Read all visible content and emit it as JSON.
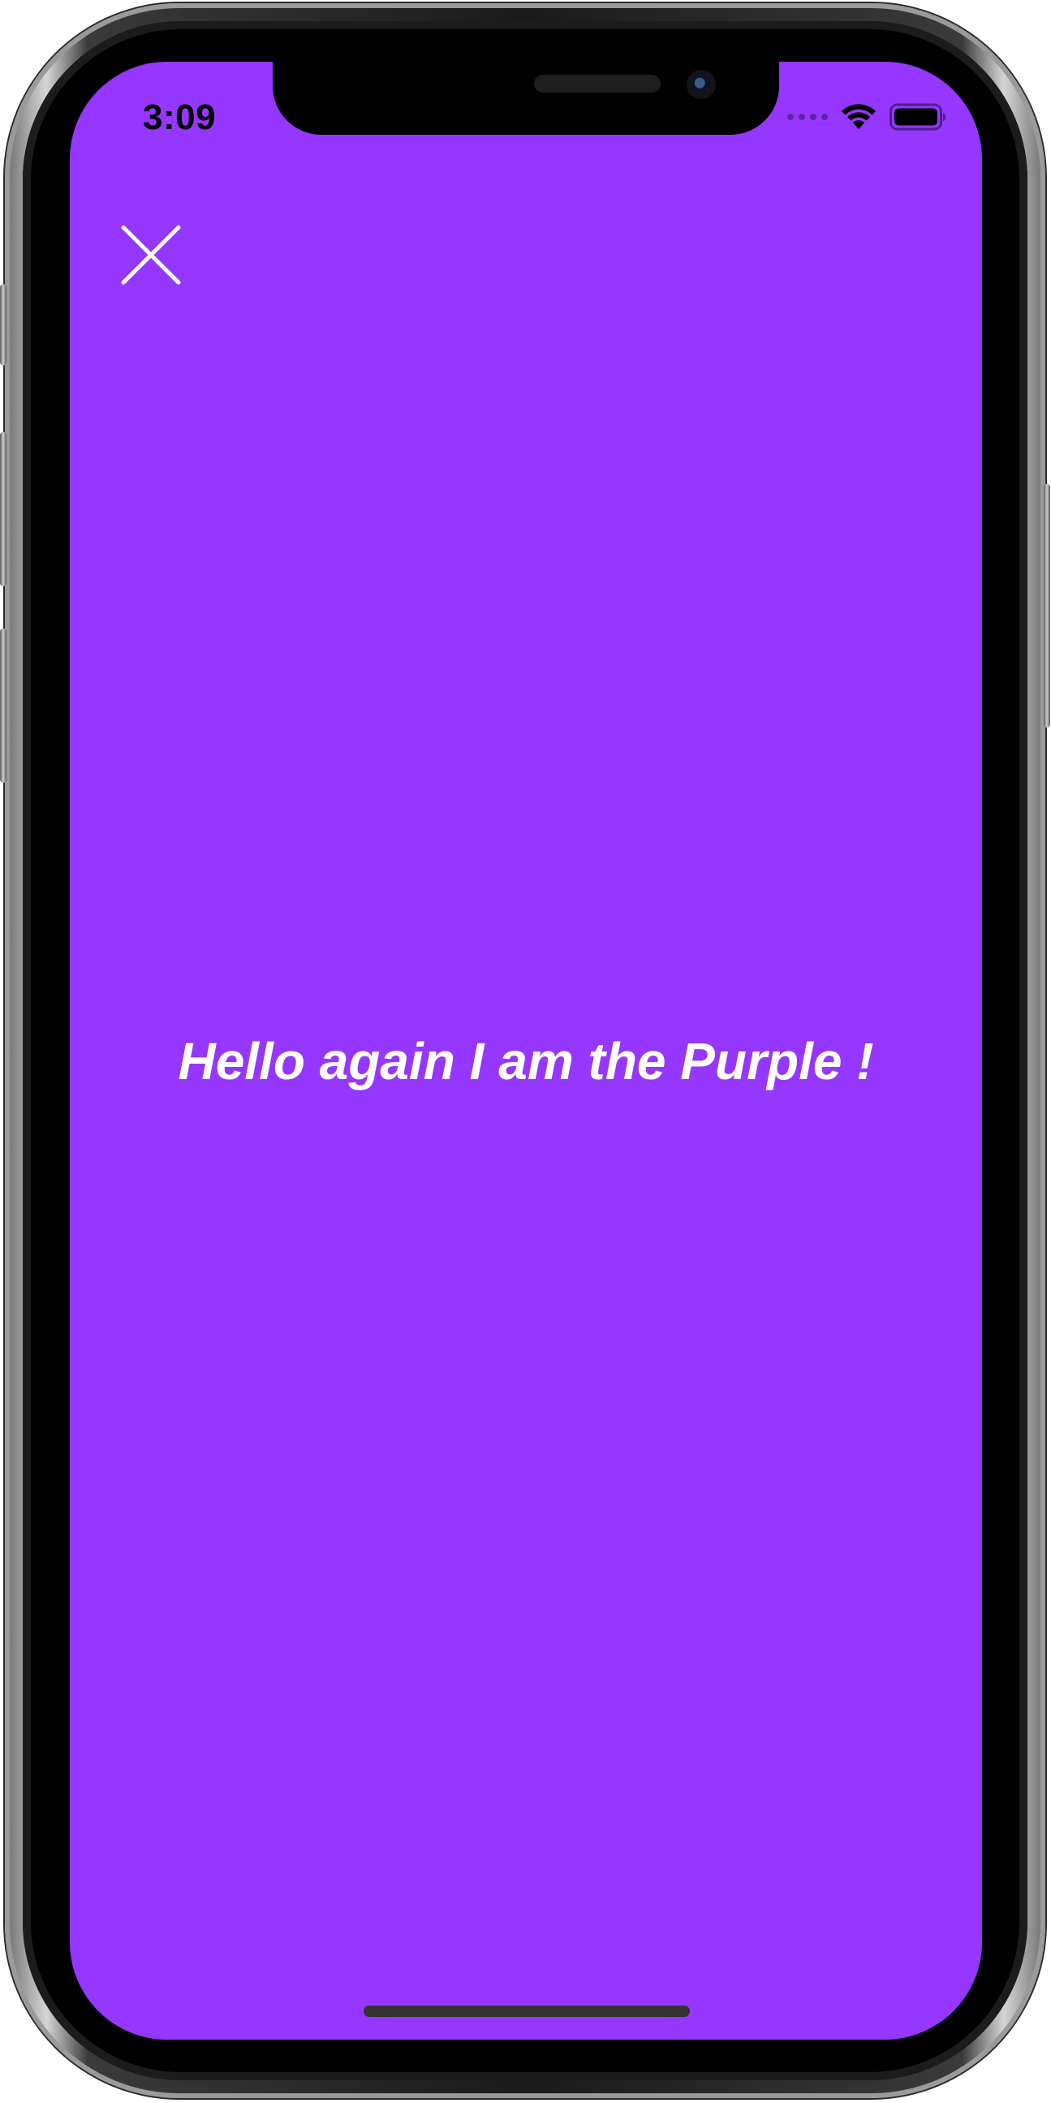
{
  "status_bar": {
    "time": "3:09"
  },
  "screen": {
    "background_color": "#9537FE",
    "message": "Hello again I am the Purple !",
    "close_icon": "close-icon"
  },
  "colors": {
    "text": "#FFFFFF",
    "home_indicator": "#333333"
  }
}
